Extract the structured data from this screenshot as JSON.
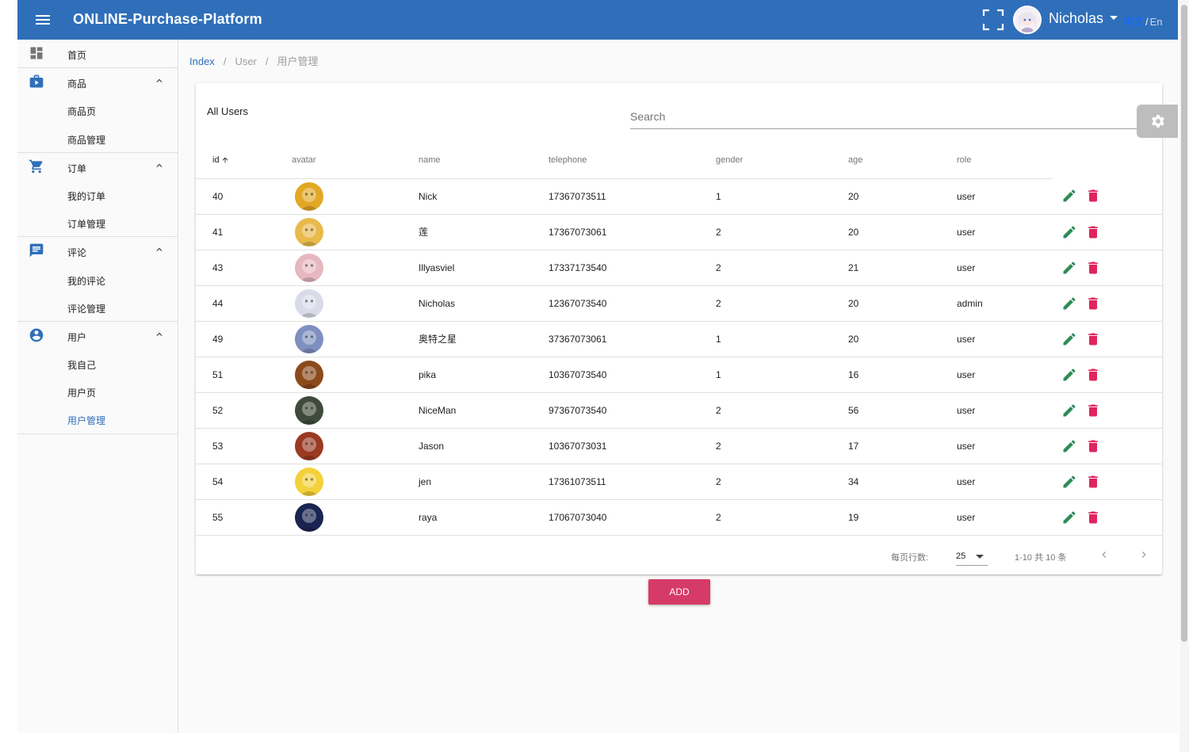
{
  "header": {
    "title": "ONLINE-Purchase-Platform",
    "user_name": "Nicholas",
    "lang_zh": "中文",
    "lang_sep": "/",
    "lang_en": "En"
  },
  "sidebar": {
    "items": [
      {
        "label": "首页",
        "icon": "dashboard-icon"
      },
      {
        "label": "商品",
        "icon": "product-icon",
        "children": [
          "商品页",
          "商品管理"
        ]
      },
      {
        "label": "订单",
        "icon": "cart-icon",
        "children": [
          "我的订单",
          "订单管理"
        ]
      },
      {
        "label": "评论",
        "icon": "comment-icon",
        "children": [
          "我的评论",
          "评论管理"
        ]
      },
      {
        "label": "用户",
        "icon": "account-icon",
        "children": [
          "我自己",
          "用户页",
          "用户管理"
        ]
      }
    ],
    "active": "用户管理"
  },
  "breadcrumb": [
    "Index",
    "User",
    "用户管理"
  ],
  "card": {
    "title": "All Users",
    "search_placeholder": "Search"
  },
  "table": {
    "columns": [
      "id",
      "avatar",
      "name",
      "telephone",
      "gender",
      "age",
      "role"
    ],
    "sort_column": "id",
    "sort_direction": "ascending",
    "rows": [
      {
        "id": "40",
        "avatar_color": "#e2a825",
        "name": "Nick",
        "telephone": "17367073511",
        "gender": "1",
        "age": "20",
        "role": "user"
      },
      {
        "id": "41",
        "avatar_color": "#e8b94b",
        "name": "莲",
        "telephone": "17367073061",
        "gender": "2",
        "age": "20",
        "role": "user"
      },
      {
        "id": "43",
        "avatar_color": "#e6b8c0",
        "name": "Illyasviel",
        "telephone": "17337173540",
        "gender": "2",
        "age": "21",
        "role": "user"
      },
      {
        "id": "44",
        "avatar_color": "#d9dbe8",
        "name": "Nicholas",
        "telephone": "12367073540",
        "gender": "2",
        "age": "20",
        "role": "admin"
      },
      {
        "id": "49",
        "avatar_color": "#7f8fc0",
        "name": "奥特之星",
        "telephone": "37367073061",
        "gender": "1",
        "age": "20",
        "role": "user"
      },
      {
        "id": "51",
        "avatar_color": "#8a4a1c",
        "name": "pika",
        "telephone": "10367073540",
        "gender": "1",
        "age": "16",
        "role": "user"
      },
      {
        "id": "52",
        "avatar_color": "#3e4a3a",
        "name": "NiceMan",
        "telephone": "97367073540",
        "gender": "2",
        "age": "56",
        "role": "user"
      },
      {
        "id": "53",
        "avatar_color": "#9a3a22",
        "name": "Jason",
        "telephone": "10367073031",
        "gender": "2",
        "age": "17",
        "role": "user"
      },
      {
        "id": "54",
        "avatar_color": "#f3d13a",
        "name": "jen",
        "telephone": "17361073511",
        "gender": "2",
        "age": "34",
        "role": "user"
      },
      {
        "id": "55",
        "avatar_color": "#1a2450",
        "name": "raya",
        "telephone": "17067073040",
        "gender": "2",
        "age": "19",
        "role": "user"
      }
    ],
    "edit_icon": "pencil-icon",
    "delete_icon": "trash-icon",
    "edit_color": "#2e8b57",
    "delete_color": "#e0245e"
  },
  "pagination": {
    "rows_per_page_label": "每页行数:",
    "rows_per_page": "25",
    "range": "1-10 共 10 条"
  },
  "add_button": "ADD",
  "colors": {
    "primary": "#2f6fba",
    "accent": "#d63a66"
  }
}
